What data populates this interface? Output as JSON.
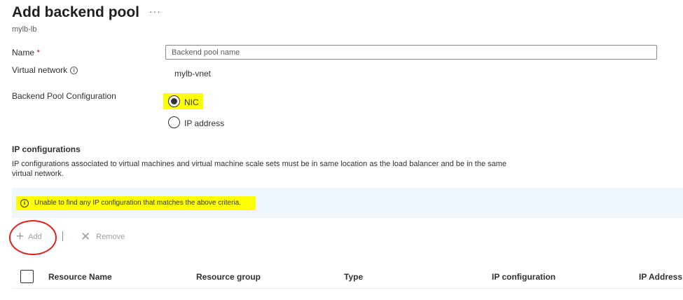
{
  "header": {
    "title": "Add backend pool",
    "more_icon": "ellipsis-icon",
    "subtitle": "mylb-lb"
  },
  "form": {
    "name_label": "Name",
    "required_marker": "*",
    "name_placeholder": "Backend pool name",
    "name_value": "",
    "vnet_label": "Virtual network",
    "vnet_info_icon": "info-icon",
    "vnet_value": "mylb-vnet",
    "pool_config_label": "Backend Pool Configuration",
    "options": [
      {
        "label": "NIC",
        "selected": true
      },
      {
        "label": "IP address",
        "selected": false
      }
    ]
  },
  "ip_configurations": {
    "title": "IP configurations",
    "description": "IP configurations associated to virtual machines and virtual machine scale sets must be in same location as the load balancer and be in the same virtual network.",
    "info_message": "Unable to find any IP configuration that matches the above criteria.",
    "info_icon": "info-icon"
  },
  "toolbar": {
    "add_label": "Add",
    "add_icon": "plus-icon",
    "remove_label": "Remove",
    "remove_icon": "close-icon"
  },
  "table": {
    "columns": [
      "Resource Name",
      "Resource group",
      "Type",
      "IP configuration",
      "IP Address"
    ]
  },
  "colors": {
    "highlight": "#ffff00",
    "annotation_circle": "#e0201b",
    "info_bar_bg": "#eff6fc",
    "disabled_text": "#a19f9d"
  }
}
